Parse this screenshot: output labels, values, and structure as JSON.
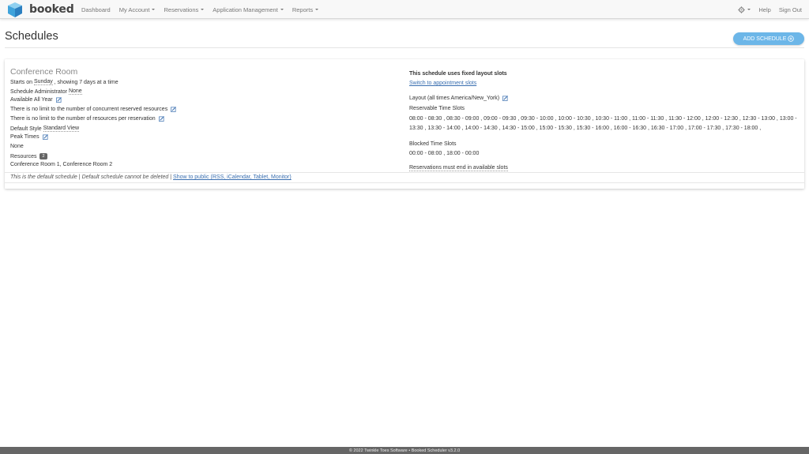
{
  "navbar": {
    "brand": "booked",
    "items": [
      {
        "label": "Dashboard",
        "dropdown": false
      },
      {
        "label": "My Account",
        "dropdown": true
      },
      {
        "label": "Reservations",
        "dropdown": true
      },
      {
        "label": "Application Management",
        "dropdown": true
      },
      {
        "label": "Reports",
        "dropdown": true
      }
    ],
    "help": "Help",
    "sign_out": "Sign Out"
  },
  "header": {
    "title": "Schedules",
    "add_button": "ADD SCHEDULE"
  },
  "schedule": {
    "name": "Conference Room",
    "starts_on_prefix": "Starts on",
    "starts_on_day": "Sunday",
    "showing": ", showing 7 days at a time",
    "admin_label": "Schedule Administrator",
    "admin_value": "None",
    "available": "Available All Year",
    "concurrent_limit": "There is no limit to the number of concurrent reserved resources",
    "resource_limit": "There is no limit to the number of resources per reservation",
    "default_style_label": "Default Style",
    "default_style_value": "Standard View",
    "peak_times": "Peak Times",
    "peak_value": "None",
    "resources_label": "Resources",
    "resources_count": "2",
    "resources_list": "Conference Room 1, Conference Room 2",
    "layout_type": "This schedule uses fixed layout slots",
    "switch_link": "Switch to appointment slots",
    "layout_label": "Layout (all times America/New_York)",
    "reservable_label": "Reservable Time Slots",
    "reservable_slots": "08:00 - 08:30 , 08:30 - 09:00 , 09:00 - 09:30 , 09:30 - 10:00 , 10:00 - 10:30 , 10:30 - 11:00 , 11:00 - 11:30 , 11:30 - 12:00 , 12:00 - 12:30 , 12:30 - 13:00 , 13:00 - 13:30 , 13:30 - 14:00 , 14:00 - 14:30 , 14:30 - 15:00 , 15:00 - 15:30 , 15:30 - 16:00 , 16:00 - 16:30 , 16:30 - 17:00 , 17:00 - 17:30 , 17:30 - 18:00 ,",
    "blocked_label": "Blocked Time Slots",
    "blocked_slots": "00:00 - 08:00 , 18:00 - 00:00",
    "end_rule": "Reservations must end in available slots",
    "default_note": "This is the default schedule",
    "cannot_delete": "Default schedule cannot be deleted",
    "separator": "|",
    "public_link": "Show to public (RSS, iCalendar, Tablet, Monitor)"
  },
  "footer": {
    "text": "© 2022 Twinkle Toes Software • Booked Scheduler v3.2.0"
  },
  "colors": {
    "accent": "#6cb6e8",
    "link": "#3a6fb0",
    "footer_bg": "#666666"
  }
}
